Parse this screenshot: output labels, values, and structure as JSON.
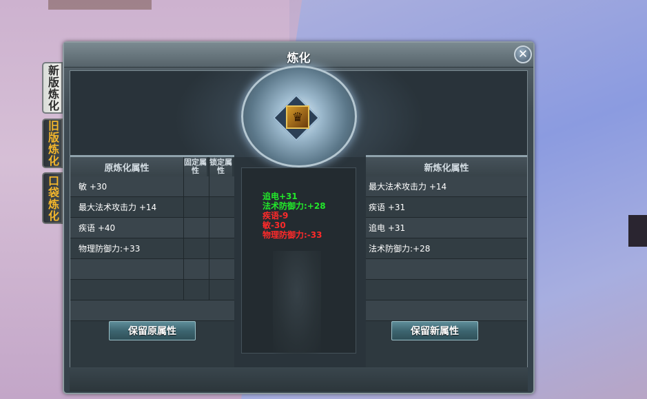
{
  "side_tabs": [
    {
      "label": "新版炼化",
      "active": true
    },
    {
      "label": "旧版炼化",
      "active": false
    },
    {
      "label": "口袋炼化",
      "active": false
    }
  ],
  "window": {
    "title": "炼化",
    "close_glyph": "✕"
  },
  "item_icon": "armor-item-icon",
  "left_panel": {
    "header": "原炼化属性",
    "fixed_header": "固定属性",
    "locked_header": "锁定属性",
    "rows": [
      "敏 +30",
      "最大法术攻击力 +14",
      "疾语 +40",
      "物理防御力:+33",
      "",
      ""
    ],
    "button": "保留原属性"
  },
  "middle_results": [
    {
      "text": "追电+31",
      "color": "#22e82a"
    },
    {
      "text": "法术防御力:+28",
      "color": "#22e82a"
    },
    {
      "text": "疾语-9",
      "color": "#ff2a2a"
    },
    {
      "text": "敏-30",
      "color": "#ff2a2a"
    },
    {
      "text": "物理防御力:-33",
      "color": "#ff2a2a"
    }
  ],
  "right_panel": {
    "header": "新炼化属性",
    "rows": [
      "最大法术攻击力 +14",
      "疾语 +31",
      "追电 +31",
      "法术防御力:+28",
      "",
      ""
    ],
    "button": "保留新属性"
  }
}
